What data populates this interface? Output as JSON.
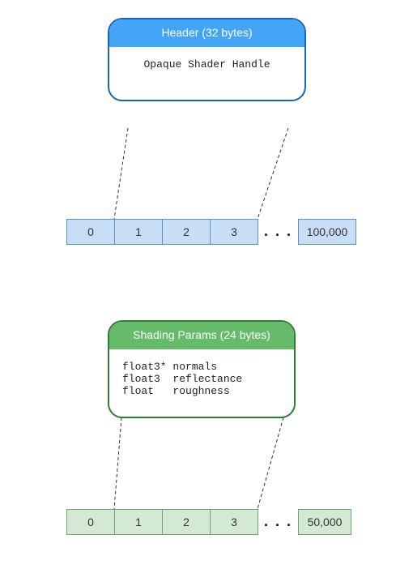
{
  "blue": {
    "callout": {
      "title": "Header (32 bytes)",
      "body": "Opaque Shader Handle"
    },
    "cells": [
      "0",
      "1",
      "2",
      "3"
    ],
    "ellipsis": ". . .",
    "last": "100,000"
  },
  "green": {
    "callout": {
      "title": "Shading Params (24 bytes)",
      "body": "float3* normals\nfloat3  reflectance\nfloat   roughness"
    },
    "cells": [
      "0",
      "1",
      "2",
      "3"
    ],
    "ellipsis": ". . .",
    "last": "50,000"
  }
}
